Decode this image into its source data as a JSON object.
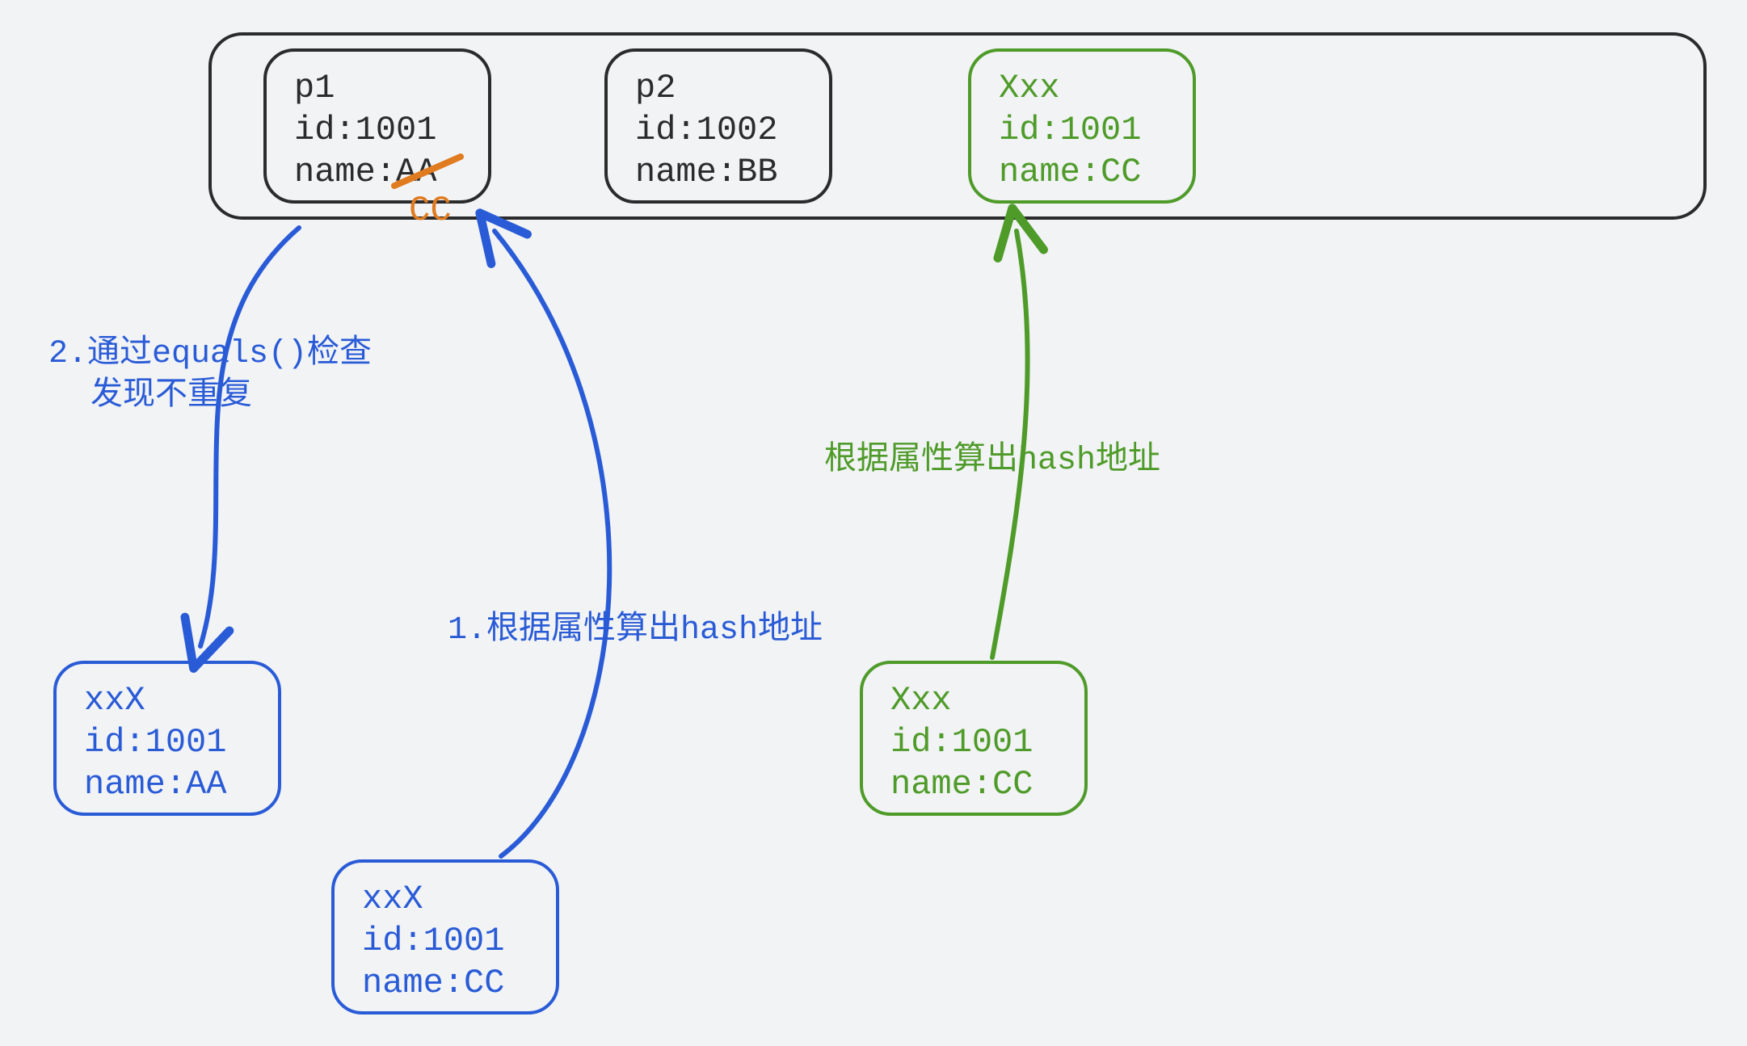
{
  "colors": {
    "black": "#2b2b2b",
    "blue": "#2a5bd7",
    "green": "#4f9b29",
    "orange": "#e07b1f",
    "bg": "#f1f3f5"
  },
  "container": {
    "slots": {
      "p1": {
        "line1": "p1",
        "line2": "id:1001",
        "line3_prefix": "name:",
        "line3_struck": "AA",
        "replacement": "CC"
      },
      "p2": {
        "line1": "p2",
        "line2": "id:1002",
        "line3": "name:BB"
      },
      "xxx_green": {
        "line1": "Xxx",
        "line2": "id:1001",
        "line3": "name:CC"
      }
    }
  },
  "nodes": {
    "blue_bottom_left": {
      "line1": "xxX",
      "line2": "id:1001",
      "line3": "name:AA"
    },
    "blue_bottom_mid": {
      "line1": "xxX",
      "line2": "id:1001",
      "line3": "name:CC"
    },
    "green_bottom": {
      "line1": "Xxx",
      "line2": "id:1001",
      "line3": "name:CC"
    }
  },
  "labels": {
    "blue_arrow_1": "1.根据属性算出hash地址",
    "blue_arrow_2_line1": "2.通过equals()检查",
    "blue_arrow_2_line2": "发现不重复",
    "green_arrow": "根据属性算出hash地址"
  }
}
